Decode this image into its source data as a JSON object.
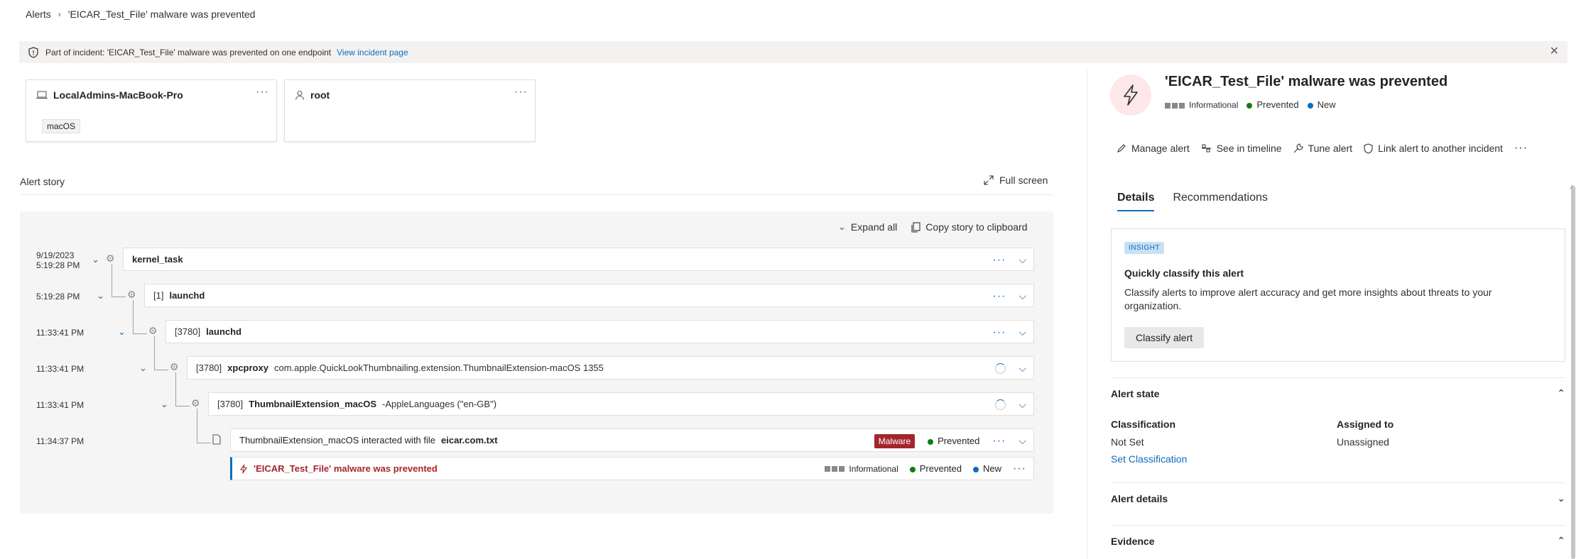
{
  "breadcrumb": {
    "root": "Alerts",
    "current": "'EICAR_Test_File' malware was prevented"
  },
  "banner": {
    "text": "Part of incident: 'EICAR_Test_File' malware was prevented on one endpoint",
    "link": "View incident page"
  },
  "entities": [
    {
      "name": "LocalAdmins-MacBook-Pro",
      "tag": "macOS",
      "icon": "laptop-icon"
    },
    {
      "name": "root",
      "icon": "user-icon"
    }
  ],
  "story": {
    "label": "Alert story",
    "fullscreen": "Full screen",
    "expand_all": "Expand all",
    "copy": "Copy story to clipboard",
    "rows": [
      {
        "date": "9/19/2023",
        "time": "5:19:28 PM",
        "pid": "",
        "name": "kernel_task",
        "args": ""
      },
      {
        "time": "5:19:28 PM",
        "pid": "[1]",
        "name": "launchd",
        "args": ""
      },
      {
        "time": "11:33:41 PM",
        "pid": "[3780]",
        "name": "launchd",
        "args": ""
      },
      {
        "time": "11:33:41 PM",
        "pid": "[3780]",
        "name": "xpcproxy",
        "args": "com.apple.QuickLookThumbnailing.extension.ThumbnailExtension-macOS 1355"
      },
      {
        "time": "11:33:41 PM",
        "pid": "[3780]",
        "name": "ThumbnailExtension_macOS",
        "args": "-AppleLanguages (\"en-GB\")"
      }
    ],
    "file_event": {
      "time": "11:34:37 PM",
      "text": "ThumbnailExtension_macOS interacted with file",
      "file": "eicar.com.txt",
      "badge": "Malware",
      "status": "Prevented"
    },
    "alert": {
      "title": "'EICAR_Test_File' malware was prevented",
      "severity": "Informational",
      "status": "Prevented",
      "state": "New"
    }
  },
  "panel": {
    "title": "'EICAR_Test_File' malware was prevented",
    "severity": "Informational",
    "status": "Prevented",
    "state": "New",
    "actions": [
      "Manage alert",
      "See in timeline",
      "Tune alert",
      "Link alert to another incident"
    ],
    "tabs": [
      "Details",
      "Recommendations"
    ],
    "insight": {
      "badge": "INSIGHT",
      "title": "Quickly classify this alert",
      "desc": "Classify alerts to improve alert accuracy and get more insights about threats to your organization.",
      "button": "Classify alert"
    },
    "alert_state": {
      "heading": "Alert state",
      "classification_label": "Classification",
      "classification_value": "Not Set",
      "set_link": "Set Classification",
      "assigned_label": "Assigned to",
      "assigned_value": "Unassigned"
    },
    "alert_details": "Alert details",
    "evidence": "Evidence"
  },
  "colors": {
    "accent": "#0f6cbd",
    "malware": "#a4262c",
    "prevented": "#107c10"
  }
}
